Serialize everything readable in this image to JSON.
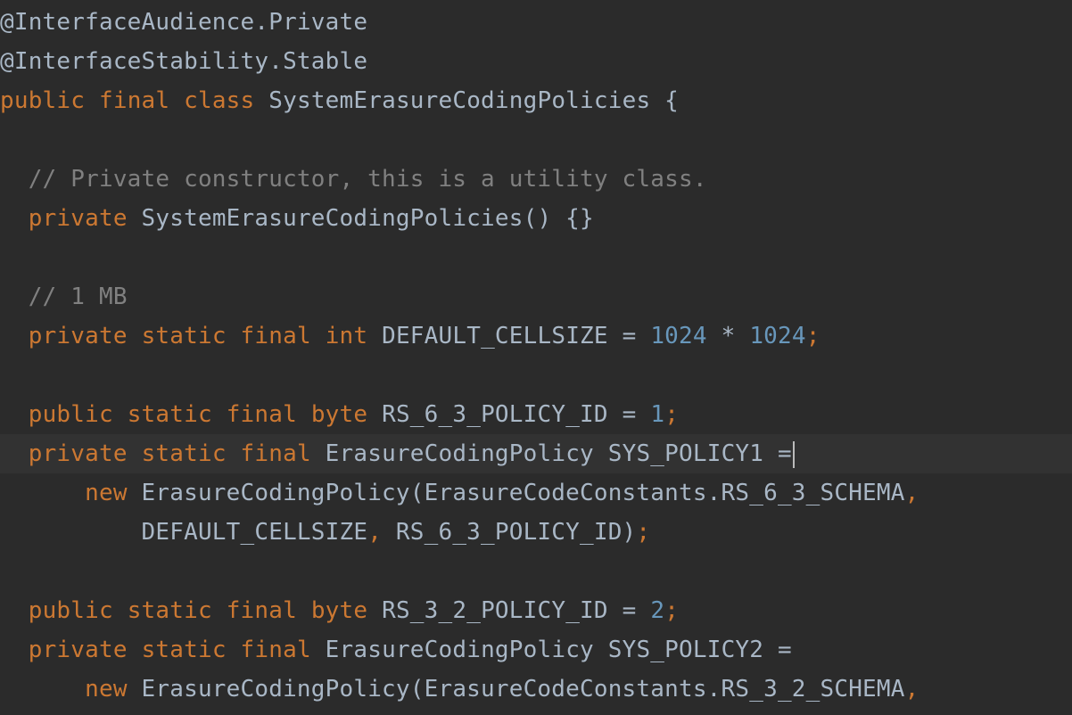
{
  "editor": {
    "language": "java",
    "colors": {
      "background": "#2b2b2b",
      "current_line": "#323232",
      "keyword": "#cc7832",
      "identifier": "#a9b7c6",
      "number": "#6897bb",
      "comment": "#808080",
      "caret": "#bbbbbb"
    },
    "lines": [
      {
        "tokens": [
          {
            "t": "@InterfaceAudience.Private",
            "k": "annid"
          }
        ]
      },
      {
        "tokens": [
          {
            "t": "@InterfaceStability.Stable",
            "k": "annid"
          }
        ]
      },
      {
        "tokens": [
          {
            "t": "public",
            "k": "kw"
          },
          {
            "t": " ",
            "k": "id"
          },
          {
            "t": "final",
            "k": "kw"
          },
          {
            "t": " ",
            "k": "id"
          },
          {
            "t": "class",
            "k": "kw"
          },
          {
            "t": " SystemErasureCodingPolicies {",
            "k": "id"
          }
        ]
      },
      {
        "tokens": []
      },
      {
        "tokens": [
          {
            "t": "  // Private constructor, this is a utility class.",
            "k": "cmt"
          }
        ]
      },
      {
        "tokens": [
          {
            "t": "  ",
            "k": "id"
          },
          {
            "t": "private",
            "k": "kw"
          },
          {
            "t": " SystemErasureCodingPolicies() {}",
            "k": "id"
          }
        ]
      },
      {
        "tokens": []
      },
      {
        "tokens": [
          {
            "t": "  // 1 MB",
            "k": "cmt"
          }
        ]
      },
      {
        "tokens": [
          {
            "t": "  ",
            "k": "id"
          },
          {
            "t": "private",
            "k": "kw"
          },
          {
            "t": " ",
            "k": "id"
          },
          {
            "t": "static",
            "k": "kw"
          },
          {
            "t": " ",
            "k": "id"
          },
          {
            "t": "final",
            "k": "kw"
          },
          {
            "t": " ",
            "k": "id"
          },
          {
            "t": "int",
            "k": "kw"
          },
          {
            "t": " DEFAULT_CELLSIZE = ",
            "k": "id"
          },
          {
            "t": "1024",
            "k": "num"
          },
          {
            "t": " * ",
            "k": "id"
          },
          {
            "t": "1024",
            "k": "num"
          },
          {
            "t": ";",
            "k": "pun"
          }
        ]
      },
      {
        "tokens": []
      },
      {
        "tokens": [
          {
            "t": "  ",
            "k": "id"
          },
          {
            "t": "public",
            "k": "kw"
          },
          {
            "t": " ",
            "k": "id"
          },
          {
            "t": "static",
            "k": "kw"
          },
          {
            "t": " ",
            "k": "id"
          },
          {
            "t": "final",
            "k": "kw"
          },
          {
            "t": " ",
            "k": "id"
          },
          {
            "t": "byte",
            "k": "kw"
          },
          {
            "t": " RS_6_3_POLICY_ID = ",
            "k": "id"
          },
          {
            "t": "1",
            "k": "num"
          },
          {
            "t": ";",
            "k": "pun"
          }
        ]
      },
      {
        "current": true,
        "caret": true,
        "tokens": [
          {
            "t": "  ",
            "k": "id"
          },
          {
            "t": "private",
            "k": "kw"
          },
          {
            "t": " ",
            "k": "id"
          },
          {
            "t": "static",
            "k": "kw"
          },
          {
            "t": " ",
            "k": "id"
          },
          {
            "t": "final",
            "k": "kw"
          },
          {
            "t": " ErasureCodingPolicy SYS_POLICY1 =",
            "k": "id"
          }
        ]
      },
      {
        "tokens": [
          {
            "t": "      ",
            "k": "id"
          },
          {
            "t": "new",
            "k": "kw"
          },
          {
            "t": " ErasureCodingPolicy(ErasureCodeConstants.RS_6_3_SCHEMA",
            "k": "id"
          },
          {
            "t": ",",
            "k": "pun"
          }
        ]
      },
      {
        "tokens": [
          {
            "t": "          DEFAULT_CELLSIZE",
            "k": "id"
          },
          {
            "t": ",",
            "k": "pun"
          },
          {
            "t": " RS_6_3_POLICY_ID)",
            "k": "id"
          },
          {
            "t": ";",
            "k": "pun"
          }
        ]
      },
      {
        "tokens": []
      },
      {
        "tokens": [
          {
            "t": "  ",
            "k": "id"
          },
          {
            "t": "public",
            "k": "kw"
          },
          {
            "t": " ",
            "k": "id"
          },
          {
            "t": "static",
            "k": "kw"
          },
          {
            "t": " ",
            "k": "id"
          },
          {
            "t": "final",
            "k": "kw"
          },
          {
            "t": " ",
            "k": "id"
          },
          {
            "t": "byte",
            "k": "kw"
          },
          {
            "t": " RS_3_2_POLICY_ID = ",
            "k": "id"
          },
          {
            "t": "2",
            "k": "num"
          },
          {
            "t": ";",
            "k": "pun"
          }
        ]
      },
      {
        "tokens": [
          {
            "t": "  ",
            "k": "id"
          },
          {
            "t": "private",
            "k": "kw"
          },
          {
            "t": " ",
            "k": "id"
          },
          {
            "t": "static",
            "k": "kw"
          },
          {
            "t": " ",
            "k": "id"
          },
          {
            "t": "final",
            "k": "kw"
          },
          {
            "t": " ErasureCodingPolicy SYS_POLICY2 =",
            "k": "id"
          }
        ]
      },
      {
        "tokens": [
          {
            "t": "      ",
            "k": "id"
          },
          {
            "t": "new",
            "k": "kw"
          },
          {
            "t": " ErasureCodingPolicy(ErasureCodeConstants.RS_3_2_SCHEMA",
            "k": "id"
          },
          {
            "t": ",",
            "k": "pun"
          }
        ]
      }
    ]
  }
}
